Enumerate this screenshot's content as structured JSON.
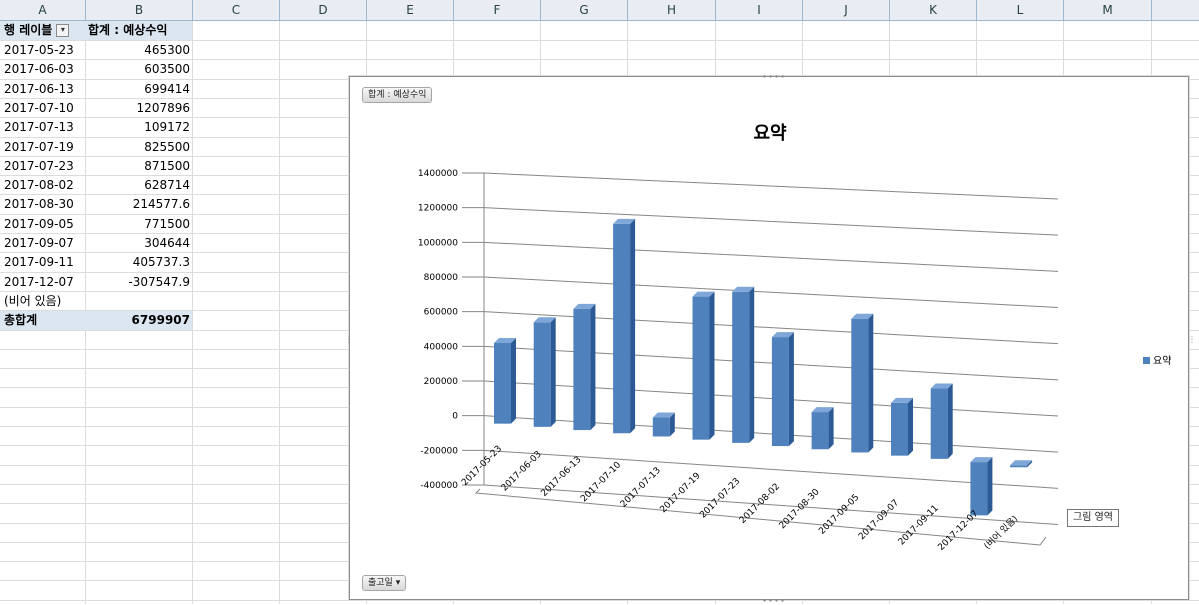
{
  "columns": [
    "A",
    "B",
    "C",
    "D",
    "E",
    "F",
    "G",
    "H",
    "I",
    "J",
    "K",
    "L",
    "M"
  ],
  "pivot": {
    "header_row_label": "행 레이블",
    "header_value_label": "합계 : 예상수익",
    "rows": [
      {
        "label": "2017-05-23",
        "value": "465300"
      },
      {
        "label": "2017-06-03",
        "value": "603500"
      },
      {
        "label": "2017-06-13",
        "value": "699414"
      },
      {
        "label": "2017-07-10",
        "value": "1207896"
      },
      {
        "label": "2017-07-13",
        "value": "109172"
      },
      {
        "label": "2017-07-19",
        "value": "825500"
      },
      {
        "label": "2017-07-23",
        "value": "871500"
      },
      {
        "label": "2017-08-02",
        "value": "628714"
      },
      {
        "label": "2017-08-30",
        "value": "214577.6"
      },
      {
        "label": "2017-09-05",
        "value": "771500"
      },
      {
        "label": "2017-09-07",
        "value": "304644"
      },
      {
        "label": "2017-09-11",
        "value": "405737.3"
      },
      {
        "label": "2017-12-07",
        "value": "-307547.9"
      },
      {
        "label": "(비어 있음)",
        "value": ""
      }
    ],
    "total_label": "총합계",
    "total_value": "6799907"
  },
  "chart": {
    "value_field_button": "합계 : 예상수익",
    "axis_field_button": "출고일",
    "tooltip": "그림 영역"
  },
  "chart_data": {
    "type": "bar",
    "title": "요약",
    "categories": [
      "2017-05-23",
      "2017-06-03",
      "2017-06-13",
      "2017-07-10",
      "2017-07-13",
      "2017-07-19",
      "2017-07-23",
      "2017-08-02",
      "2017-08-30",
      "2017-09-05",
      "2017-09-07",
      "2017-09-11",
      "2017-12-07",
      "(비어 있음)"
    ],
    "series": [
      {
        "name": "요약",
        "values": [
          465300,
          603500,
          699414,
          1207896,
          109172,
          825500,
          871500,
          628714,
          214577.6,
          771500,
          304644,
          405737.3,
          -307547.9,
          0
        ]
      }
    ],
    "ylim": [
      -400000,
      1400000
    ],
    "yticks": [
      "1400000",
      "1200000",
      "1000000",
      "800000",
      "600000",
      "400000",
      "200000",
      "0",
      "-200000",
      "-400000"
    ],
    "legend_position": "right",
    "grid": true,
    "style": "3d-column",
    "colors": {
      "bar": "#4f81bd",
      "bar_side": "#2c5a94",
      "bar_top": "#7fa6d8"
    }
  }
}
